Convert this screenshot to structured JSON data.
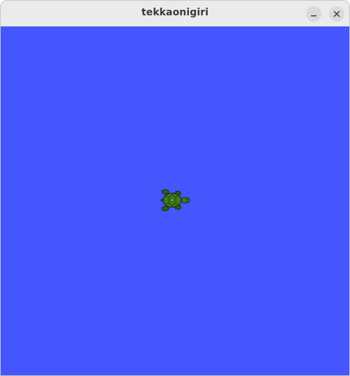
{
  "window": {
    "title": "tekkaonigiri"
  },
  "titlebar_buttons": {
    "minimize_icon": "minimize-icon",
    "close_icon": "close-icon"
  },
  "canvas": {
    "background_color": "#4556ff",
    "sprite": "turtle-icon",
    "turtle_heading": "right"
  },
  "colors": {
    "titlebar": "#ebebeb",
    "title_text": "#3a3a3a",
    "turtle_shell": "#3f7a1f",
    "turtle_skin": "#2f5e16"
  }
}
